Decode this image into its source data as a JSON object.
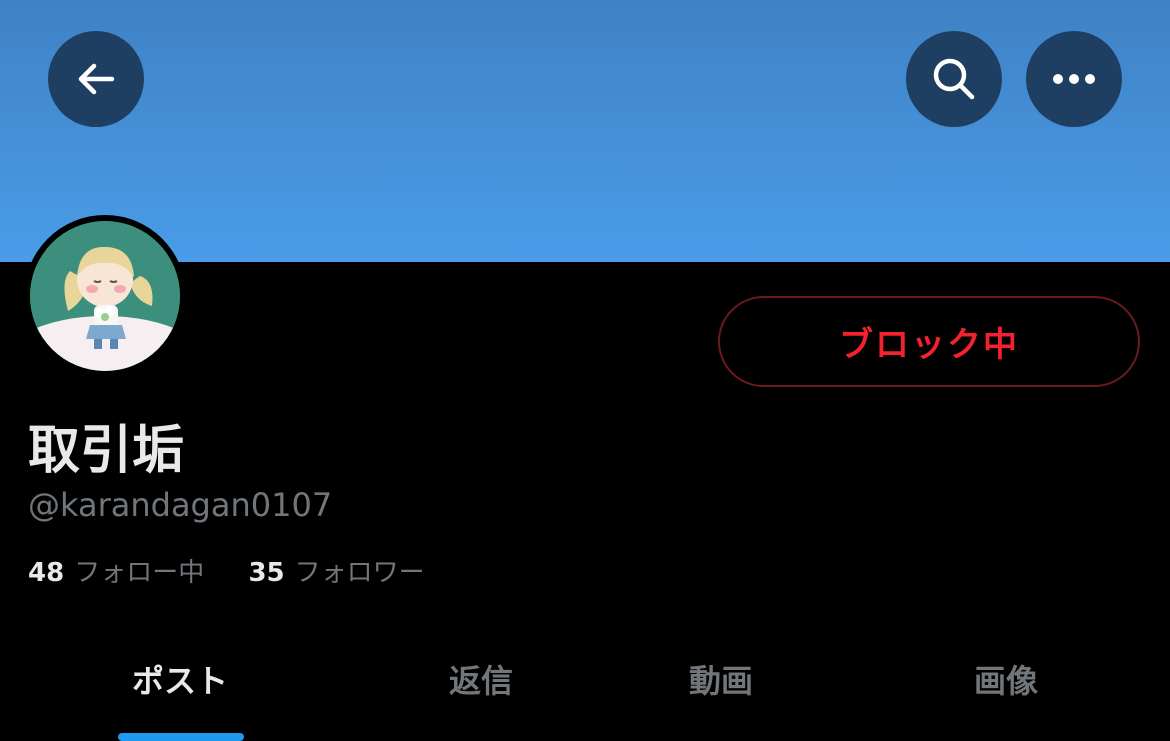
{
  "header": {
    "back_icon": "arrow-left-icon",
    "search_icon": "search-icon",
    "more_icon": "more-horizontal-icon"
  },
  "profile": {
    "display_name": "取引垢",
    "handle": "@karandagan0107",
    "block_button_label": "ブロック中",
    "block_color": "#f4212e",
    "banner_color": "#4a9ce8"
  },
  "stats": {
    "following_count": "48",
    "following_label": "フォロー中",
    "followers_count": "35",
    "followers_label": "フォロワー"
  },
  "tabs": [
    {
      "label": "ポスト",
      "active": true
    },
    {
      "label": "返信",
      "active": false
    },
    {
      "label": "動画",
      "active": false
    },
    {
      "label": "画像",
      "active": false
    }
  ]
}
